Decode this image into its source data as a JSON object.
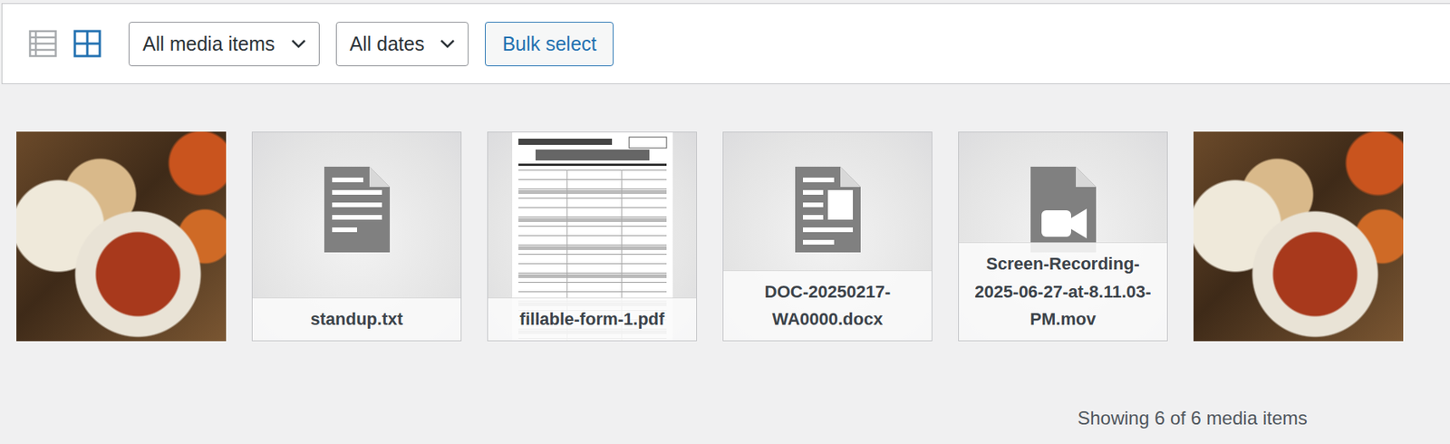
{
  "toolbar": {
    "views": [
      {
        "kind": "list",
        "selected": false
      },
      {
        "kind": "grid",
        "selected": true
      }
    ],
    "filters": [
      {
        "label": "All media items"
      },
      {
        "label": "All dates"
      }
    ],
    "bulk_select": "Bulk select"
  },
  "items": [
    {
      "kind": "image"
    },
    {
      "kind": "text",
      "filename": "standup.txt"
    },
    {
      "kind": "pdf",
      "filename": "fillable-form-1.pdf"
    },
    {
      "kind": "document",
      "filename": "DOC-20250217-WA0000.docx"
    },
    {
      "kind": "video",
      "filename": "Screen-Recording-2025-06-27-at-8.11.03-PM.mov"
    },
    {
      "kind": "image"
    }
  ],
  "status": "Showing 6 of 6 media items"
}
